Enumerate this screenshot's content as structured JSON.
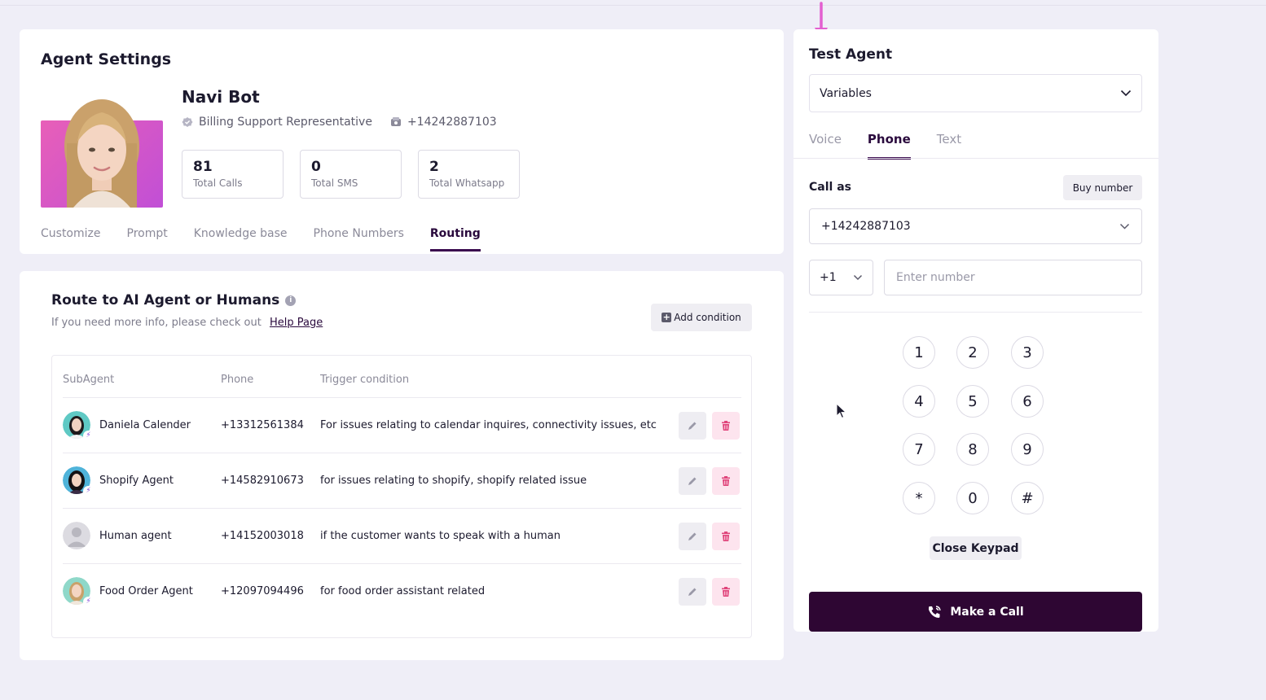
{
  "agent_settings": {
    "title": "Agent Settings",
    "agent_name": "Navi Bot",
    "role": "Billing Support Representative",
    "phone": "+14242887103",
    "stats": [
      {
        "value": "81",
        "label": "Total Calls"
      },
      {
        "value": "0",
        "label": "Total SMS"
      },
      {
        "value": "2",
        "label": "Total Whatsapp"
      }
    ],
    "tabs": [
      "Customize",
      "Prompt",
      "Knowledge base",
      "Phone Numbers",
      "Routing"
    ],
    "active_tab": "Routing"
  },
  "routing": {
    "title": "Route to AI Agent or Humans",
    "subtitle": "If you need more info, please check out",
    "help_link": "Help Page",
    "add_button": "Add condition",
    "columns": [
      "SubAgent",
      "Phone",
      "Trigger condition"
    ],
    "rows": [
      {
        "name": "Daniela Calender",
        "phone": "+13312561384",
        "trigger": "For issues relating to calendar inquires, connectivity issues, etc"
      },
      {
        "name": "Shopify Agent",
        "phone": "+14582910673",
        "trigger": "for issues relating to shopify, shopify related issue"
      },
      {
        "name": "Human agent",
        "phone": "+14152003018",
        "trigger": "if the customer wants to speak with a human"
      },
      {
        "name": "Food Order Agent",
        "phone": "+12097094496",
        "trigger": "for food order assistant related"
      }
    ]
  },
  "test_agent": {
    "title": "Test Agent",
    "variables_label": "Variables",
    "tabs": [
      "Voice",
      "Phone",
      "Text"
    ],
    "active_tab": "Phone",
    "call_as_label": "Call as",
    "buy_number": "Buy number",
    "from_number": "+14242887103",
    "country_code": "+1",
    "number_placeholder": "Enter number",
    "keys": [
      "1",
      "2",
      "3",
      "4",
      "5",
      "6",
      "7",
      "8",
      "9",
      "*",
      "0",
      "#"
    ],
    "close_keypad": "Close Keypad",
    "make_call": "Make a Call"
  },
  "colors": {
    "accent": "#2e0633",
    "delete": "#e0457b",
    "page_bg": "#efeef7",
    "arrow": "#e35fd0"
  },
  "icons": [
    "verified-badge-icon",
    "phone-device-icon",
    "info-icon",
    "plus-icon",
    "edit-icon",
    "trash-icon",
    "chevron-down-icon",
    "phone-call-icon",
    "arrow-down-icon",
    "mouse-cursor-icon"
  ]
}
